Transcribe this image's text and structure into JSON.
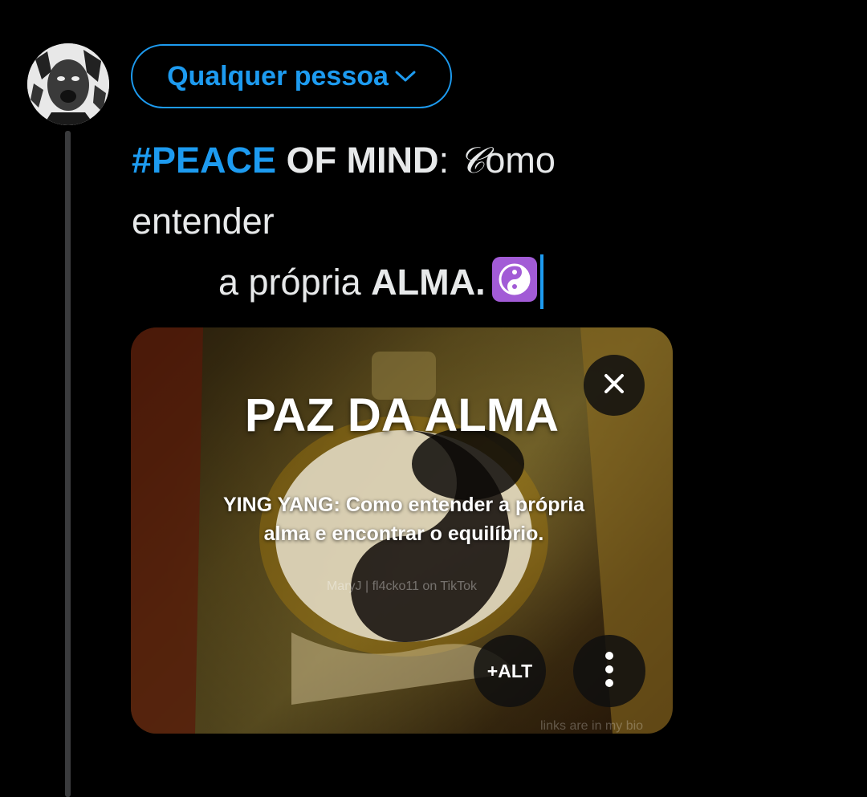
{
  "audience": {
    "label": "Qualquer pessoa",
    "icon": "chevron-down-icon"
  },
  "compose": {
    "line1_hashtag": "#PEACE",
    "line1_bold": " OF MIND",
    "line1_colon": ": ",
    "line1_script_letter": "𝒞",
    "line1_rest": "omo",
    "line2": "entender",
    "line3_text": "a própria ",
    "line3_bold": "ALMA.",
    "emoji": "yin-yang-icon"
  },
  "media": {
    "title": "PAZ DA ALMA",
    "subtitle": "YING YANG: Como entender a própria alma e encontrar o equilíbrio.",
    "credit": "MaryJ | fl4cko11 on TikTok",
    "watermark": "links are in my bio",
    "alt_label": "+ALT",
    "close_icon": "close-icon",
    "more_icon": "more-vertical-icon"
  },
  "colors": {
    "accent": "#1d9bf0",
    "text": "#e7e9ea",
    "background": "#000000",
    "emoji_bg": "#a25bd6"
  }
}
